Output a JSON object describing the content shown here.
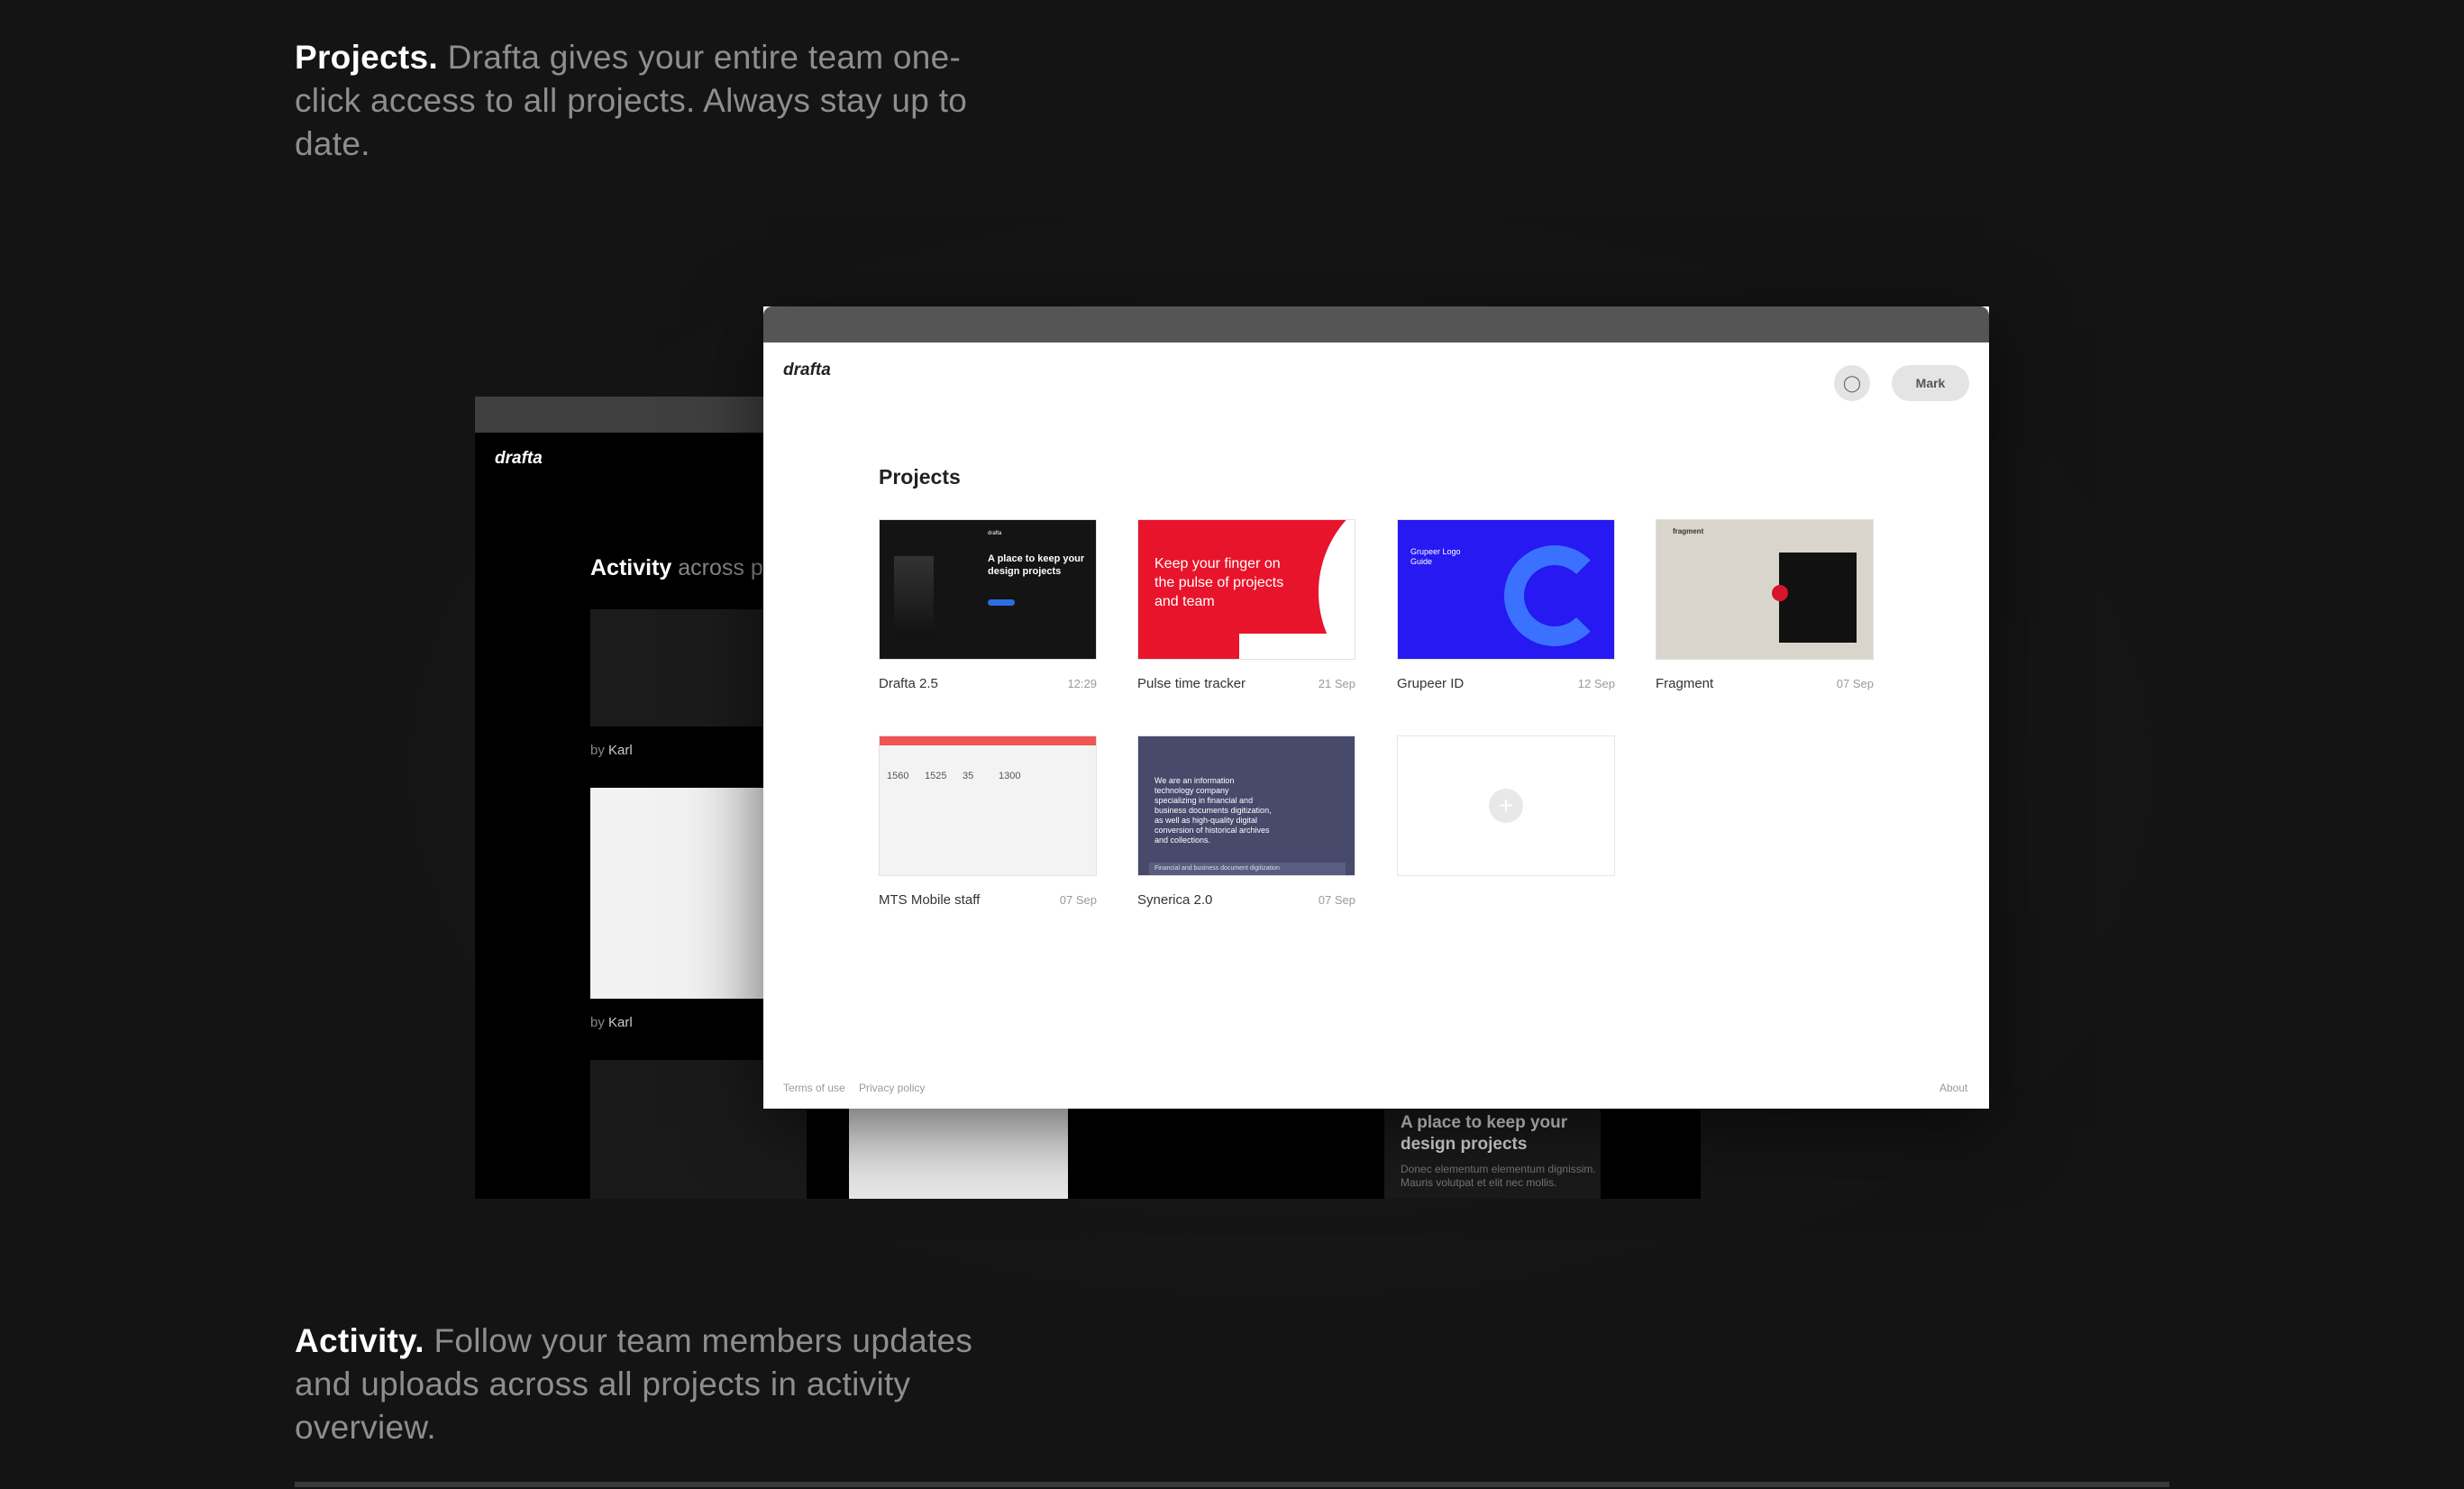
{
  "features": {
    "projects": {
      "title": "Projects.",
      "text": " Drafta gives your entire team one-click access to all projects. Always stay up to date."
    },
    "activity": {
      "title": "Activity.",
      "text": " Follow your team members updates and uploads across all projects in activity overview."
    }
  },
  "back_window": {
    "logo": "drafta",
    "title_bold": "Activity",
    "title_rest": " across pr",
    "entries": [
      {
        "by": "by",
        "author": "Karl"
      },
      {
        "by": "by",
        "author": "Karl"
      }
    ],
    "hero_heading": "A place to keep your design projects",
    "hero_sub": "Donec elementum elementum dignissim. Mauris volutpat et elit nec mollis."
  },
  "front_window": {
    "logo": "drafta",
    "icon_button": "bulb-icon",
    "user_button": "Mark",
    "title": "Projects",
    "projects": [
      {
        "name": "Drafta 2.5",
        "date": "12:29",
        "thumb_text": "A place to keep your design projects",
        "thumb_logo": "drafta"
      },
      {
        "name": "Pulse time tracker",
        "date": "21 Sep",
        "thumb_text": "Keep your finger on the pulse of projects and team"
      },
      {
        "name": "Grupeer ID",
        "date": "12 Sep",
        "thumb_text": "Grupeer Logo Guide"
      },
      {
        "name": "Fragment",
        "date": "07 Sep",
        "thumb_logo": "fragment"
      },
      {
        "name": "MTS Mobile staff",
        "date": "07 Sep",
        "thumb_numbers": [
          "1560",
          "1525",
          "35",
          "1300"
        ]
      },
      {
        "name": "Synerica 2.0",
        "date": "07 Sep",
        "thumb_text": "We are an information technology company specializing in financial and business documents digitization, as well as high-quality digital conversion of historical archives and collections.",
        "thumb_band": "Financial and business document digitization"
      }
    ],
    "add_label": "+",
    "footer": {
      "terms": "Terms of use",
      "privacy": "Privacy policy",
      "about": "About"
    }
  },
  "colors": {
    "background": "#141414",
    "accent_red": "#e8142b",
    "accent_blue": "#2619f2"
  }
}
